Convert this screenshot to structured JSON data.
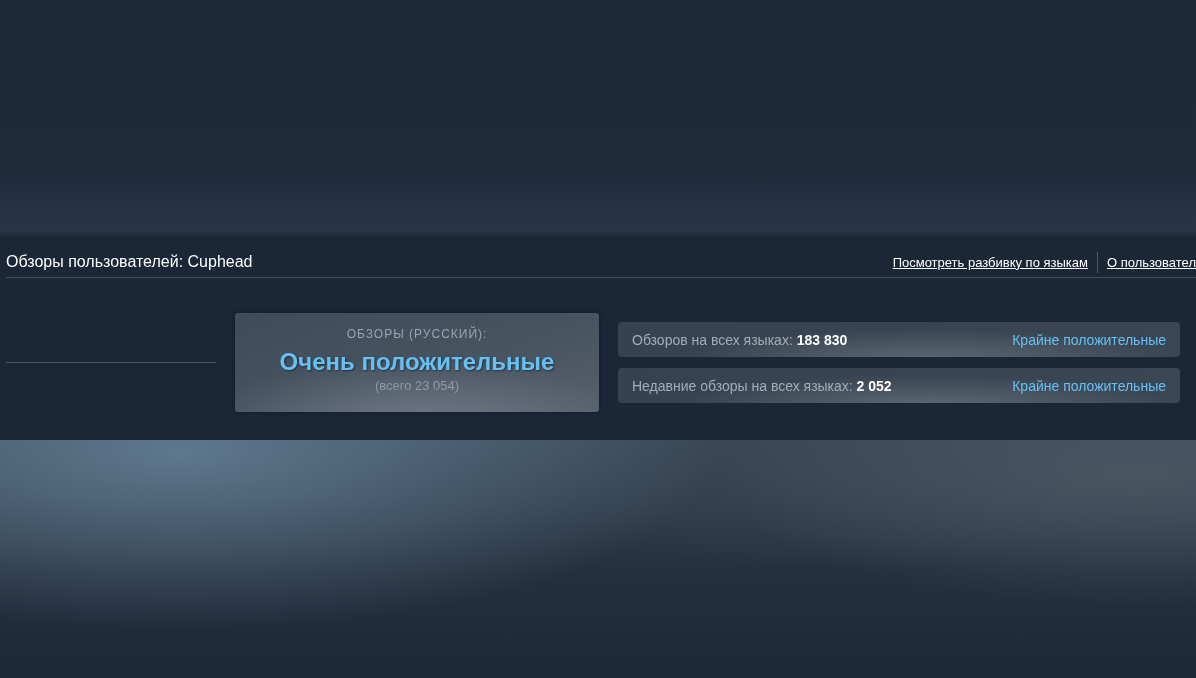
{
  "header": {
    "title": "Обзоры пользователей: Cuphead",
    "links": [
      "Посмотреть разбивку по языкам",
      "О пользовател"
    ]
  },
  "summary": {
    "label": "ОБЗОРЫ (РУССКИЙ):",
    "rating": "Очень положительные",
    "total": "(всего 23 054)"
  },
  "stats": [
    {
      "label": "Обзоров на всех языках: **183 830**",
      "rating": "Крайне положительные"
    },
    {
      "label": "Недавние обзоры на всех языках: **2 052**",
      "rating": "Крайне положительные"
    }
  ]
}
